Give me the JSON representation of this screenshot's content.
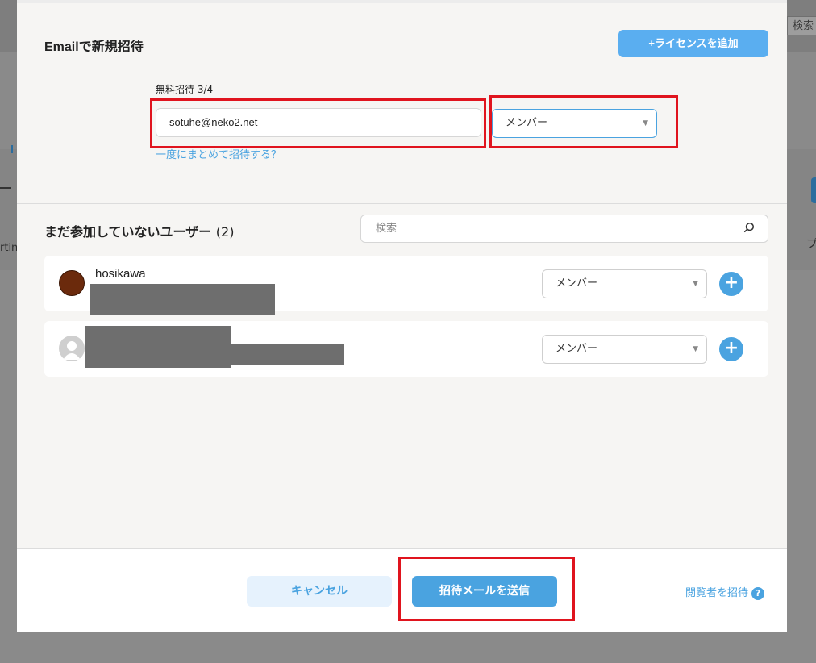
{
  "background": {
    "search_label": "検索",
    "left_text": "rtin",
    "right_text": "プ"
  },
  "invite": {
    "title": "Emailで新規招待",
    "add_license_label": "+ライセンスを追加",
    "free_label": "無料招待 3/4",
    "email_value": "sotuhe@neko2.net",
    "role_value": "メンバー",
    "bulk_link": "一度にまとめて招待する？"
  },
  "pending": {
    "title": "まだ参加していないユーザー",
    "count": "(2)",
    "search_placeholder": "検索",
    "users": [
      {
        "name": "hosikawa",
        "role": "メンバー",
        "plus": "+"
      },
      {
        "name": "",
        "role": "メンバー",
        "plus": "+"
      }
    ]
  },
  "footer": {
    "cancel_label": "キャンセル",
    "send_label": "招待メールを送信",
    "viewer_link": "閲覧者を招待",
    "help_glyph": "?"
  },
  "colors": {
    "accent": "#4aa3e0",
    "highlight": "#e0141e",
    "overlay": "#8a8a8a"
  }
}
